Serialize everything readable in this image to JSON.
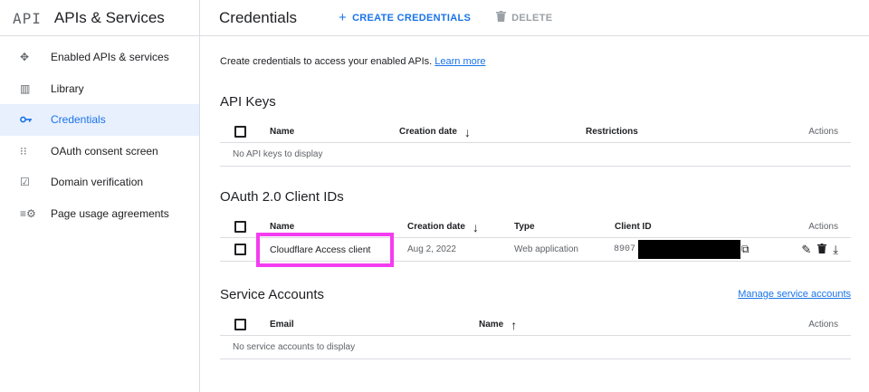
{
  "header": {
    "logo": "API",
    "app_title": "APIs & Services",
    "page_title": "Credentials",
    "create_label": "CREATE CREDENTIALS",
    "delete_label": "DELETE"
  },
  "sidebar": {
    "items": [
      {
        "label": "Enabled APIs & services",
        "icon": "api-diamond-icon"
      },
      {
        "label": "Library",
        "icon": "library-icon"
      },
      {
        "label": "Credentials",
        "icon": "key-icon",
        "active": true
      },
      {
        "label": "OAuth consent screen",
        "icon": "consent-icon"
      },
      {
        "label": "Domain verification",
        "icon": "domain-icon"
      },
      {
        "label": "Page usage agreements",
        "icon": "settings-list-icon"
      }
    ]
  },
  "intro": {
    "text": "Create credentials to access your enabled APIs.",
    "link": "Learn more"
  },
  "api_keys": {
    "title": "API Keys",
    "columns": [
      "Name",
      "Creation date",
      "Restrictions",
      "Actions"
    ],
    "empty": "No API keys to display"
  },
  "oauth": {
    "title": "OAuth 2.0 Client IDs",
    "columns": [
      "Name",
      "Creation date",
      "Type",
      "Client ID",
      "Actions"
    ],
    "rows": [
      {
        "name": "Cloudflare Access client",
        "date": "Aug 2, 2022",
        "type": "Web application",
        "client_id": "8907"
      }
    ]
  },
  "service_accounts": {
    "title": "Service Accounts",
    "manage_link": "Manage service accounts",
    "columns": [
      "Email",
      "Name",
      "Actions"
    ],
    "empty": "No service accounts to display"
  },
  "colors": {
    "accent": "#1a73e8",
    "active_bg": "#e8f0fe",
    "highlight": "#f43cf1"
  }
}
